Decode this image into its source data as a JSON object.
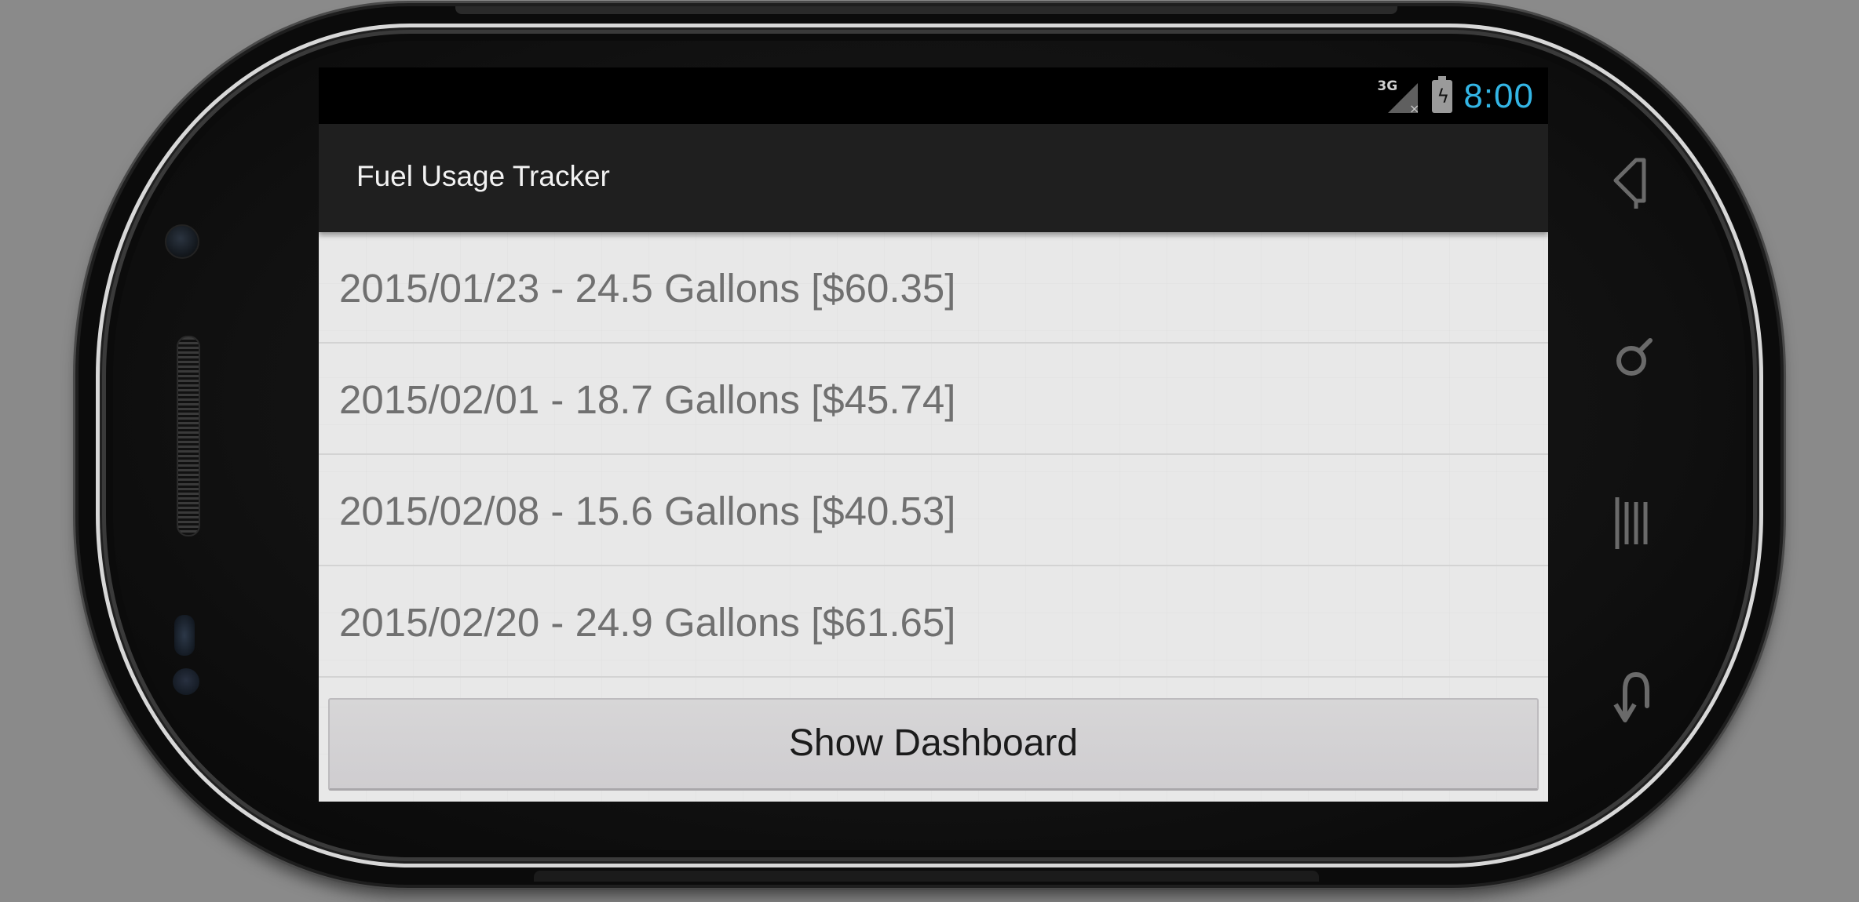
{
  "status_bar": {
    "network": "3G",
    "network_signal_icon": "signal-no-service-icon",
    "battery_icon": "battery-charging-icon",
    "time": "8:00",
    "time_color": "#33b5e5"
  },
  "action_bar": {
    "title": "Fuel Usage Tracker"
  },
  "fuel_entries": [
    {
      "label": "2015/01/23 - 24.5 Gallons [$60.35]"
    },
    {
      "label": "2015/02/01 - 18.7 Gallons [$45.74]"
    },
    {
      "label": "2015/02/08 - 15.6 Gallons [$40.53]"
    },
    {
      "label": "2015/02/20 - 24.9 Gallons [$61.65]"
    }
  ],
  "show_dashboard_button": {
    "label": "Show Dashboard"
  },
  "hardware_keys": [
    "home-icon",
    "search-icon",
    "menu-icon",
    "back-icon"
  ]
}
